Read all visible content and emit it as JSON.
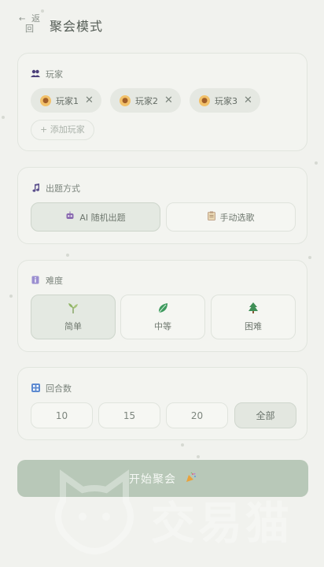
{
  "header": {
    "back_label_top": "返",
    "back_label_bottom": "回",
    "title": "聚会模式"
  },
  "players": {
    "title": "玩家",
    "icon": "people-icon",
    "list": [
      {
        "name": "玩家1"
      },
      {
        "name": "玩家2"
      },
      {
        "name": "玩家3"
      }
    ],
    "add_label": "+ 添加玩家"
  },
  "question_mode": {
    "title": "出题方式",
    "icon": "music-note-icon",
    "options": [
      {
        "label": "AI 随机出题",
        "icon": "robot-icon",
        "selected": true
      },
      {
        "label": "手动选歌",
        "icon": "clipboard-icon",
        "selected": false
      }
    ]
  },
  "difficulty": {
    "title": "难度",
    "icon": "info-icon",
    "options": [
      {
        "label": "简单",
        "icon": "sprout-icon",
        "selected": true
      },
      {
        "label": "中等",
        "icon": "leaf-icon",
        "selected": false
      },
      {
        "label": "困难",
        "icon": "tree-icon",
        "selected": false
      }
    ]
  },
  "rounds": {
    "title": "回合数",
    "icon": "grid-icon",
    "options": [
      {
        "label": "10",
        "selected": false
      },
      {
        "label": "15",
        "selected": false
      },
      {
        "label": "20",
        "selected": false
      },
      {
        "label": "全部",
        "selected": true
      }
    ]
  },
  "start_button": {
    "label": "开始聚会",
    "icon": "party-popper-icon"
  },
  "watermark": {
    "text": "交易猫"
  },
  "colors": {
    "background": "#f1f2ee",
    "accent": "#b8c8b8",
    "text": "#6f7a70"
  }
}
